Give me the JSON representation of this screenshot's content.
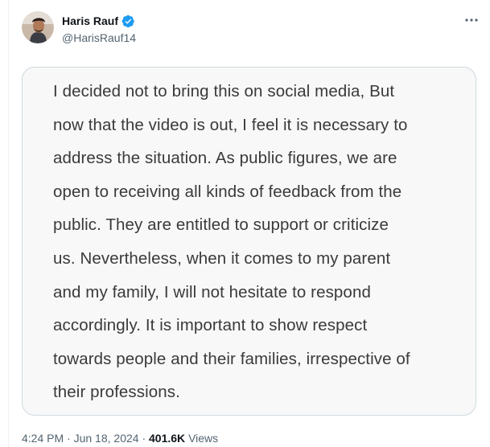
{
  "tweet": {
    "author": {
      "display_name": "Haris Rauf",
      "handle": "@HarisRauf14",
      "verified": true,
      "verified_color": "#1d9bf0"
    },
    "more_icon": "more-horizontal-icon",
    "statement_lines": [
      "I decided not to bring this on social media, But",
      "now that the video is out, I feel it is necessary to",
      "address the situation. As public figures, we are",
      "open to receiving all kinds of feedback from the",
      "public. They are entitled to support or criticize",
      "us. Nevertheless, when it comes to my parent",
      "and my family, I will not hesitate to respond",
      "accordingly. It is important to show respect",
      "towards people and their families, irrespective of",
      "their professions."
    ],
    "meta": {
      "time": "4:24 PM",
      "separator": "·",
      "date": "Jun 18, 2024",
      "views_count": "401.6K",
      "views_label": "Views"
    }
  }
}
